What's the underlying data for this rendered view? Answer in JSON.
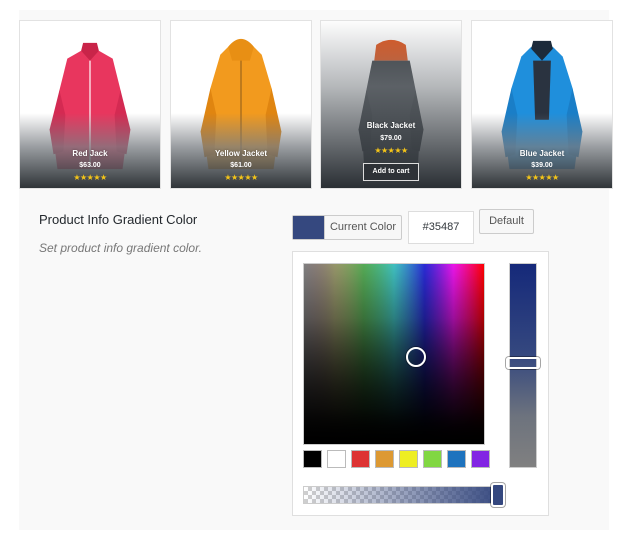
{
  "products": [
    {
      "name": "Red Jack",
      "price": "$63.00",
      "stars": "★★★★★"
    },
    {
      "name": "Yellow Jacket",
      "price": "$61.00",
      "stars": "★★★★★"
    },
    {
      "name": "Black Jacket",
      "price": "$79.00",
      "stars": "★★★★★",
      "add_to_cart": "Add to cart"
    },
    {
      "name": "Blue Jacket",
      "price": "$39.00",
      "stars": "★★★★★"
    }
  ],
  "setting": {
    "title": "Product Info Gradient Color",
    "description": "Set product info gradient color."
  },
  "color_picker": {
    "current_color_label": "Current Color",
    "hex_value": "#35487",
    "default_label": "Default",
    "current_color": "#35487f",
    "palette": [
      "#000000",
      "#ffffff",
      "#dd3333",
      "#dd9933",
      "#eeee22",
      "#81d742",
      "#1e73be",
      "#8224e3"
    ]
  }
}
